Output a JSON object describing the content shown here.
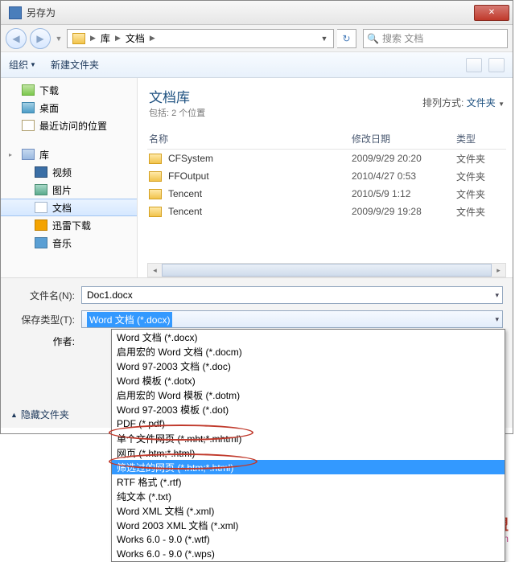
{
  "dialog": {
    "title": "另存为"
  },
  "breadcrumb": {
    "root": "库",
    "sub": "文档"
  },
  "search": {
    "placeholder": "搜索 文档"
  },
  "toolbar": {
    "organize": "组织",
    "newfolder": "新建文件夹"
  },
  "tree": {
    "download": "下载",
    "desktop": "桌面",
    "recent": "最近访问的位置",
    "libraries": "库",
    "video": "视频",
    "pictures": "图片",
    "documents": "文档",
    "thunder": "迅雷下载",
    "music": "音乐"
  },
  "library": {
    "title": "文档库",
    "subtitle": "包括: 2 个位置",
    "arrange_label": "排列方式:",
    "arrange_value": "文件夹"
  },
  "columns": {
    "name": "名称",
    "date": "修改日期",
    "type": "类型"
  },
  "files": [
    {
      "name": "CFSystem",
      "date": "2009/9/29 20:20",
      "type": "文件夹"
    },
    {
      "name": "FFOutput",
      "date": "2010/4/27 0:53",
      "type": "文件夹"
    },
    {
      "name": "Tencent",
      "date": "2010/5/9 1:12",
      "type": "文件夹"
    },
    {
      "name": "Tencent",
      "date": "2009/9/29 19:28",
      "type": "文件夹"
    }
  ],
  "fields": {
    "filename_label": "文件名(N):",
    "filename_value": "Doc1.docx",
    "savetype_label": "保存类型(T):",
    "savetype_value": "Word 文档 (*.docx)",
    "author_label": "作者:"
  },
  "hide_folders": "隐藏文件夹",
  "type_options": [
    "Word 文档 (*.docx)",
    "启用宏的 Word 文档 (*.docm)",
    "Word 97-2003 文档 (*.doc)",
    "Word 模板 (*.dotx)",
    "启用宏的 Word 模板 (*.dotm)",
    "Word 97-2003 模板 (*.dot)",
    "PDF (*.pdf)",
    "单个文件网页 (*.mht;*.mhtml)",
    "网页 (*.htm;*.html)",
    "筛选过的网页 (*.htm;*.html)",
    "RTF 格式 (*.rtf)",
    "纯文本 (*.txt)",
    "Word XML 文档 (*.xml)",
    "Word 2003 XML 文档 (*.xml)",
    "Works 6.0 - 9.0 (*.wtf)",
    "Works 6.0 - 9.0 (*.wps)"
  ],
  "highlight_index": 9,
  "watermark": {
    "url": "www.wordlm.com"
  }
}
